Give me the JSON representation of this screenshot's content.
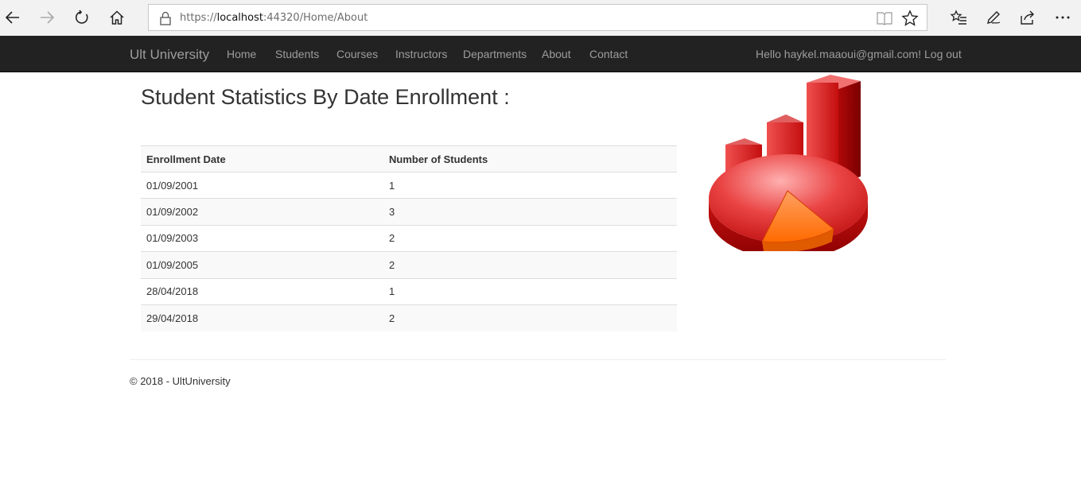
{
  "browser": {
    "url_prefix": "https://",
    "url_host": "localhost",
    "url_rest": ":44320/Home/About"
  },
  "navbar": {
    "brand": "Ult University",
    "links": [
      "Home",
      "Students",
      "Courses",
      "Instructors",
      "Departments",
      "About",
      "Contact"
    ],
    "greeting": "Hello haykel.maaoui@gmail.com!",
    "logout": "Log out"
  },
  "main": {
    "title": "Student Statistics By Date Enrollment :",
    "table": {
      "headers": [
        "Enrollment Date",
        "Number of Students"
      ],
      "rows": [
        [
          "01/09/2001",
          "1"
        ],
        [
          "01/09/2002",
          "3"
        ],
        [
          "01/09/2003",
          "2"
        ],
        [
          "01/09/2005",
          "2"
        ],
        [
          "28/04/2018",
          "1"
        ],
        [
          "29/04/2018",
          "2"
        ]
      ]
    },
    "illustration": "3d-bar-pie-chart-graphic"
  },
  "footer": {
    "text": "© 2018 - UltUniversity"
  },
  "colors": {
    "navbar_bg": "#222222",
    "nav_text": "#9d9d9d",
    "chart_red": "#d41414",
    "chart_orange": "#ff6a00"
  }
}
